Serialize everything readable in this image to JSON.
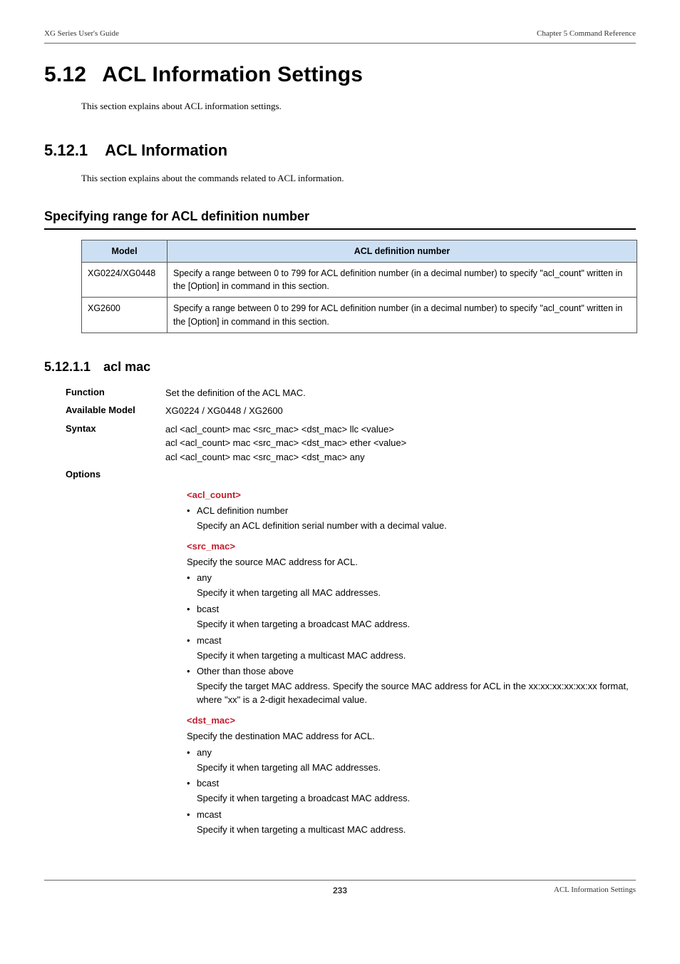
{
  "header": {
    "left": "XG Series User's Guide",
    "right": "Chapter 5 Command Reference"
  },
  "section": {
    "number": "5.12",
    "title": "ACL Information Settings",
    "intro": "This section explains about ACL information settings."
  },
  "subsection": {
    "number": "5.12.1",
    "title": "ACL Information",
    "intro": "This section explains about the commands related to ACL information."
  },
  "range_heading": "Specifying range for ACL definition number",
  "table": {
    "headers": [
      "Model",
      "ACL definition number"
    ],
    "rows": [
      {
        "model": "XG0224/XG0448",
        "desc": "Specify a range between 0 to 799 for ACL definition number (in a decimal number) to specify \"acl_count\" written in the [Option] in command in this section."
      },
      {
        "model": "XG2600",
        "desc": "Specify a range between 0 to 299 for ACL definition number (in a decimal number) to specify \"acl_count\" written in the [Option] in command in this section."
      }
    ]
  },
  "command": {
    "number": "5.12.1.1",
    "title": "acl mac",
    "function_label": "Function",
    "function_value": "Set the definition of the ACL MAC.",
    "model_label": "Available Model",
    "model_value": "XG0224 / XG0448 / XG2600",
    "syntax_label": "Syntax",
    "syntax_lines": [
      "acl <acl_count> mac <src_mac> <dst_mac> llc <value>",
      "acl <acl_count> mac <src_mac> <dst_mac> ether <value>",
      "acl <acl_count> mac <src_mac> <dst_mac> any"
    ],
    "options_label": "Options",
    "options": [
      {
        "name": "<acl_count>",
        "desc": "",
        "items": [
          {
            "head": "ACL definition number",
            "sub": "Specify an ACL definition serial number with a decimal value."
          }
        ]
      },
      {
        "name": "<src_mac>",
        "desc": "Specify the source MAC address for ACL.",
        "items": [
          {
            "head": "any",
            "sub": "Specify it when targeting all MAC addresses."
          },
          {
            "head": "bcast",
            "sub": "Specify it when targeting a broadcast MAC address."
          },
          {
            "head": "mcast",
            "sub": "Specify it when targeting a multicast MAC address."
          },
          {
            "head": "Other than those above",
            "sub": "Specify the target MAC address. Specify the source MAC address for ACL in the xx:xx:xx:xx:xx:xx format, where \"xx\" is a 2-digit hexadecimal value."
          }
        ]
      },
      {
        "name": "<dst_mac>",
        "desc": "Specify the destination MAC address for ACL.",
        "items": [
          {
            "head": "any",
            "sub": "Specify it when targeting all MAC addresses."
          },
          {
            "head": "bcast",
            "sub": "Specify it when targeting a broadcast MAC address."
          },
          {
            "head": "mcast",
            "sub": "Specify it when targeting a multicast MAC address."
          }
        ]
      }
    ]
  },
  "footer": {
    "page": "233",
    "right": "ACL Information Settings"
  }
}
